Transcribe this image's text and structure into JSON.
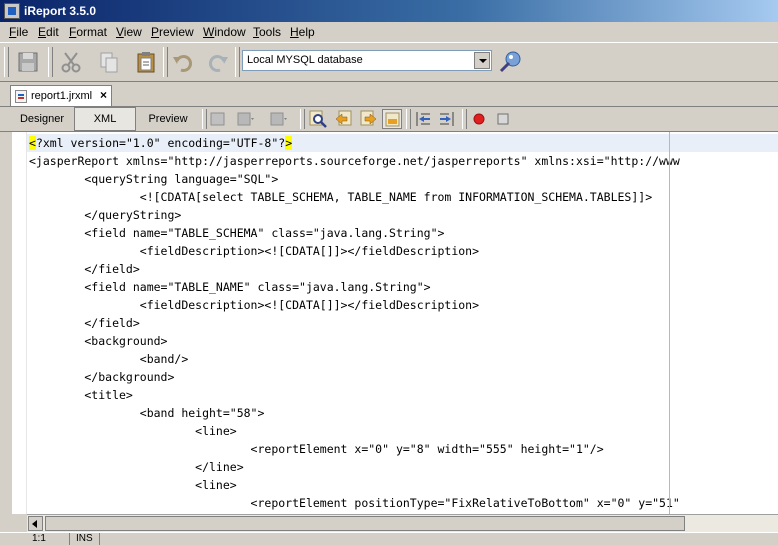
{
  "window": {
    "title": "iReport 3.5.0"
  },
  "menu": [
    "File",
    "Edit",
    "Format",
    "View",
    "Preview",
    "Window",
    "Tools",
    "Help"
  ],
  "datasource": {
    "selected": "Local MYSQL database"
  },
  "document_tab": {
    "label": "report1.jrxml",
    "close": "×"
  },
  "view_tabs": {
    "designer": "Designer",
    "xml": "XML",
    "preview": "Preview"
  },
  "code_lines": [
    "<?xml version=\"1.0\" encoding=\"UTF-8\"?>",
    "<jasperReport xmlns=\"http://jasperreports.sourceforge.net/jasperreports\" xmlns:xsi=\"http://www",
    "        <queryString language=\"SQL\">",
    "                <![CDATA[select TABLE_SCHEMA, TABLE_NAME from INFORMATION_SCHEMA.TABLES]]>",
    "        </queryString>",
    "        <field name=\"TABLE_SCHEMA\" class=\"java.lang.String\">",
    "                <fieldDescription><![CDATA[]]></fieldDescription>",
    "        </field>",
    "        <field name=\"TABLE_NAME\" class=\"java.lang.String\">",
    "                <fieldDescription><![CDATA[]]></fieldDescription>",
    "        </field>",
    "        <background>",
    "                <band/>",
    "        </background>",
    "        <title>",
    "                <band height=\"58\">",
    "                        <line>",
    "                                <reportElement x=\"0\" y=\"8\" width=\"555\" height=\"1\"/>",
    "                        </line>",
    "                        <line>",
    "                                <reportElement positionType=\"FixRelativeToBottom\" x=\"0\" y=\"51\""
  ],
  "status": {
    "position": "1:1",
    "mode": "INS"
  }
}
